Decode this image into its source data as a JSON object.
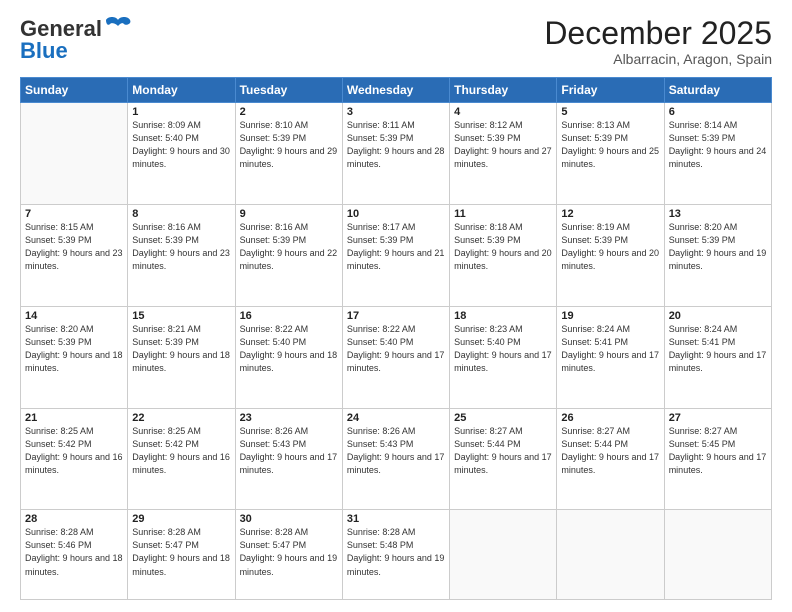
{
  "header": {
    "logo_general": "General",
    "logo_blue": "Blue",
    "month_title": "December 2025",
    "subtitle": "Albarracin, Aragon, Spain"
  },
  "weekdays": [
    "Sunday",
    "Monday",
    "Tuesday",
    "Wednesday",
    "Thursday",
    "Friday",
    "Saturday"
  ],
  "weeks": [
    [
      {
        "day": "",
        "sunrise": "",
        "sunset": "",
        "daylight": ""
      },
      {
        "day": "1",
        "sunrise": "Sunrise: 8:09 AM",
        "sunset": "Sunset: 5:40 PM",
        "daylight": "Daylight: 9 hours and 30 minutes."
      },
      {
        "day": "2",
        "sunrise": "Sunrise: 8:10 AM",
        "sunset": "Sunset: 5:39 PM",
        "daylight": "Daylight: 9 hours and 29 minutes."
      },
      {
        "day": "3",
        "sunrise": "Sunrise: 8:11 AM",
        "sunset": "Sunset: 5:39 PM",
        "daylight": "Daylight: 9 hours and 28 minutes."
      },
      {
        "day": "4",
        "sunrise": "Sunrise: 8:12 AM",
        "sunset": "Sunset: 5:39 PM",
        "daylight": "Daylight: 9 hours and 27 minutes."
      },
      {
        "day": "5",
        "sunrise": "Sunrise: 8:13 AM",
        "sunset": "Sunset: 5:39 PM",
        "daylight": "Daylight: 9 hours and 25 minutes."
      },
      {
        "day": "6",
        "sunrise": "Sunrise: 8:14 AM",
        "sunset": "Sunset: 5:39 PM",
        "daylight": "Daylight: 9 hours and 24 minutes."
      }
    ],
    [
      {
        "day": "7",
        "sunrise": "Sunrise: 8:15 AM",
        "sunset": "Sunset: 5:39 PM",
        "daylight": "Daylight: 9 hours and 23 minutes."
      },
      {
        "day": "8",
        "sunrise": "Sunrise: 8:16 AM",
        "sunset": "Sunset: 5:39 PM",
        "daylight": "Daylight: 9 hours and 23 minutes."
      },
      {
        "day": "9",
        "sunrise": "Sunrise: 8:16 AM",
        "sunset": "Sunset: 5:39 PM",
        "daylight": "Daylight: 9 hours and 22 minutes."
      },
      {
        "day": "10",
        "sunrise": "Sunrise: 8:17 AM",
        "sunset": "Sunset: 5:39 PM",
        "daylight": "Daylight: 9 hours and 21 minutes."
      },
      {
        "day": "11",
        "sunrise": "Sunrise: 8:18 AM",
        "sunset": "Sunset: 5:39 PM",
        "daylight": "Daylight: 9 hours and 20 minutes."
      },
      {
        "day": "12",
        "sunrise": "Sunrise: 8:19 AM",
        "sunset": "Sunset: 5:39 PM",
        "daylight": "Daylight: 9 hours and 20 minutes."
      },
      {
        "day": "13",
        "sunrise": "Sunrise: 8:20 AM",
        "sunset": "Sunset: 5:39 PM",
        "daylight": "Daylight: 9 hours and 19 minutes."
      }
    ],
    [
      {
        "day": "14",
        "sunrise": "Sunrise: 8:20 AM",
        "sunset": "Sunset: 5:39 PM",
        "daylight": "Daylight: 9 hours and 18 minutes."
      },
      {
        "day": "15",
        "sunrise": "Sunrise: 8:21 AM",
        "sunset": "Sunset: 5:39 PM",
        "daylight": "Daylight: 9 hours and 18 minutes."
      },
      {
        "day": "16",
        "sunrise": "Sunrise: 8:22 AM",
        "sunset": "Sunset: 5:40 PM",
        "daylight": "Daylight: 9 hours and 18 minutes."
      },
      {
        "day": "17",
        "sunrise": "Sunrise: 8:22 AM",
        "sunset": "Sunset: 5:40 PM",
        "daylight": "Daylight: 9 hours and 17 minutes."
      },
      {
        "day": "18",
        "sunrise": "Sunrise: 8:23 AM",
        "sunset": "Sunset: 5:40 PM",
        "daylight": "Daylight: 9 hours and 17 minutes."
      },
      {
        "day": "19",
        "sunrise": "Sunrise: 8:24 AM",
        "sunset": "Sunset: 5:41 PM",
        "daylight": "Daylight: 9 hours and 17 minutes."
      },
      {
        "day": "20",
        "sunrise": "Sunrise: 8:24 AM",
        "sunset": "Sunset: 5:41 PM",
        "daylight": "Daylight: 9 hours and 17 minutes."
      }
    ],
    [
      {
        "day": "21",
        "sunrise": "Sunrise: 8:25 AM",
        "sunset": "Sunset: 5:42 PM",
        "daylight": "Daylight: 9 hours and 16 minutes."
      },
      {
        "day": "22",
        "sunrise": "Sunrise: 8:25 AM",
        "sunset": "Sunset: 5:42 PM",
        "daylight": "Daylight: 9 hours and 16 minutes."
      },
      {
        "day": "23",
        "sunrise": "Sunrise: 8:26 AM",
        "sunset": "Sunset: 5:43 PM",
        "daylight": "Daylight: 9 hours and 17 minutes."
      },
      {
        "day": "24",
        "sunrise": "Sunrise: 8:26 AM",
        "sunset": "Sunset: 5:43 PM",
        "daylight": "Daylight: 9 hours and 17 minutes."
      },
      {
        "day": "25",
        "sunrise": "Sunrise: 8:27 AM",
        "sunset": "Sunset: 5:44 PM",
        "daylight": "Daylight: 9 hours and 17 minutes."
      },
      {
        "day": "26",
        "sunrise": "Sunrise: 8:27 AM",
        "sunset": "Sunset: 5:44 PM",
        "daylight": "Daylight: 9 hours and 17 minutes."
      },
      {
        "day": "27",
        "sunrise": "Sunrise: 8:27 AM",
        "sunset": "Sunset: 5:45 PM",
        "daylight": "Daylight: 9 hours and 17 minutes."
      }
    ],
    [
      {
        "day": "28",
        "sunrise": "Sunrise: 8:28 AM",
        "sunset": "Sunset: 5:46 PM",
        "daylight": "Daylight: 9 hours and 18 minutes."
      },
      {
        "day": "29",
        "sunrise": "Sunrise: 8:28 AM",
        "sunset": "Sunset: 5:47 PM",
        "daylight": "Daylight: 9 hours and 18 minutes."
      },
      {
        "day": "30",
        "sunrise": "Sunrise: 8:28 AM",
        "sunset": "Sunset: 5:47 PM",
        "daylight": "Daylight: 9 hours and 19 minutes."
      },
      {
        "day": "31",
        "sunrise": "Sunrise: 8:28 AM",
        "sunset": "Sunset: 5:48 PM",
        "daylight": "Daylight: 9 hours and 19 minutes."
      },
      {
        "day": "",
        "sunrise": "",
        "sunset": "",
        "daylight": ""
      },
      {
        "day": "",
        "sunrise": "",
        "sunset": "",
        "daylight": ""
      },
      {
        "day": "",
        "sunrise": "",
        "sunset": "",
        "daylight": ""
      }
    ]
  ]
}
